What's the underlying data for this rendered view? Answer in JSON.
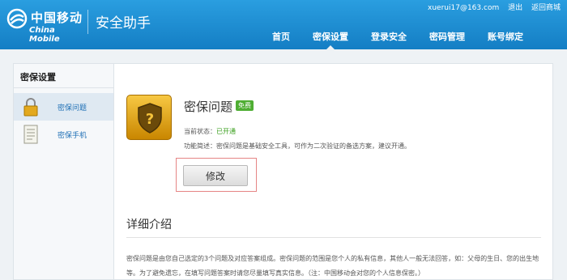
{
  "header": {
    "logo_cn": "中国移动",
    "logo_en": "China Mobile",
    "app_title": "安全助手",
    "user_email": "xuerui17@163.com",
    "logout": "退出",
    "back_to_mall": "返回商城"
  },
  "nav": {
    "items": [
      {
        "label": "首页"
      },
      {
        "label": "密保设置"
      },
      {
        "label": "登录安全"
      },
      {
        "label": "密码管理"
      },
      {
        "label": "账号绑定"
      }
    ],
    "active": "密保设置"
  },
  "sidebar": {
    "title": "密保设置",
    "items": [
      {
        "label": "密保问题",
        "icon": "lock-icon"
      },
      {
        "label": "密保手机",
        "icon": "document-icon"
      }
    ]
  },
  "feature": {
    "title": "密保问题",
    "badge": "免费",
    "status_label": "当前状态：",
    "status_value": "已开通",
    "description": "功能简述：密保问题是基础安全工具，可作为二次验证的备选方案，建议开通。",
    "edit_button": "修改"
  },
  "details": {
    "title": "详细介绍",
    "text": "密保问题是由您自己选定的3个问题及对应答案组成。密保问题的范围是您个人的私有信息，其他人一般无法回答，如：父母的生日、您的出生地等。为了避免遗忘，在填写问题答案时请您尽量填写真实信息。（注：中国移动会对您的个人信息保密。）"
  },
  "colors": {
    "header_blue": "#1e8fd3",
    "link_blue": "#1e6fb5",
    "status_green": "#3a9f1d",
    "highlight_red": "#e68585"
  }
}
